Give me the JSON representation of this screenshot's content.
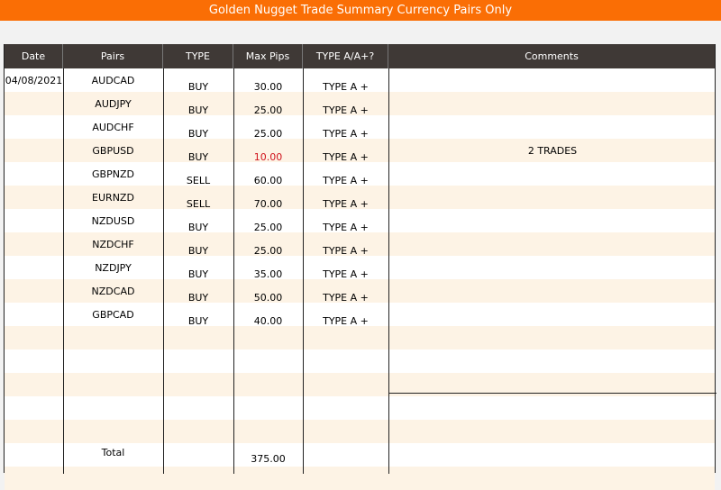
{
  "banner": {
    "title": "Golden Nugget Trade Summary Currency Pairs Only"
  },
  "headers": {
    "date": "Date",
    "pairs": "Pairs",
    "type": "TYPE",
    "max_pips": "Max Pips",
    "type_aa": "TYPE A/A+?",
    "comments": "Comments"
  },
  "date_value": "04/08/2021",
  "rows": [
    {
      "pair": "AUDCAD",
      "type": "BUY",
      "pips": "30.00",
      "grade": "TYPE A +"
    },
    {
      "pair": "AUDJPY",
      "type": "BUY",
      "pips": "25.00",
      "grade": "TYPE A +"
    },
    {
      "pair": "AUDCHF",
      "type": "BUY",
      "pips": "25.00",
      "grade": "TYPE A +"
    },
    {
      "pair": "GBPUSD",
      "type": "BUY",
      "pips": "10.00",
      "grade": "TYPE A +"
    },
    {
      "pair": "GBPNZD",
      "type": "SELL",
      "pips": "60.00",
      "grade": "TYPE A +"
    },
    {
      "pair": "EURNZD",
      "type": "SELL",
      "pips": "70.00",
      "grade": "TYPE A +"
    },
    {
      "pair": "NZDUSD",
      "type": "BUY",
      "pips": "25.00",
      "grade": "TYPE A +"
    },
    {
      "pair": "NZDCHF",
      "type": "BUY",
      "pips": "25.00",
      "grade": "TYPE A +"
    },
    {
      "pair": "NZDJPY",
      "type": "BUY",
      "pips": "35.00",
      "grade": "TYPE A +"
    },
    {
      "pair": "NZDCAD",
      "type": "BUY",
      "pips": "50.00",
      "grade": "TYPE A +"
    },
    {
      "pair": "GBPCAD",
      "type": "BUY",
      "pips": "40.00",
      "grade": "TYPE A +"
    }
  ],
  "comment": "2 TRADES",
  "total": {
    "label": "Total",
    "value": "375.00"
  },
  "colors": {
    "banner": "#fa6e05",
    "header": "#3f3936",
    "stripe": "#fdf3e5",
    "highlight_pips": "#d0121b"
  }
}
